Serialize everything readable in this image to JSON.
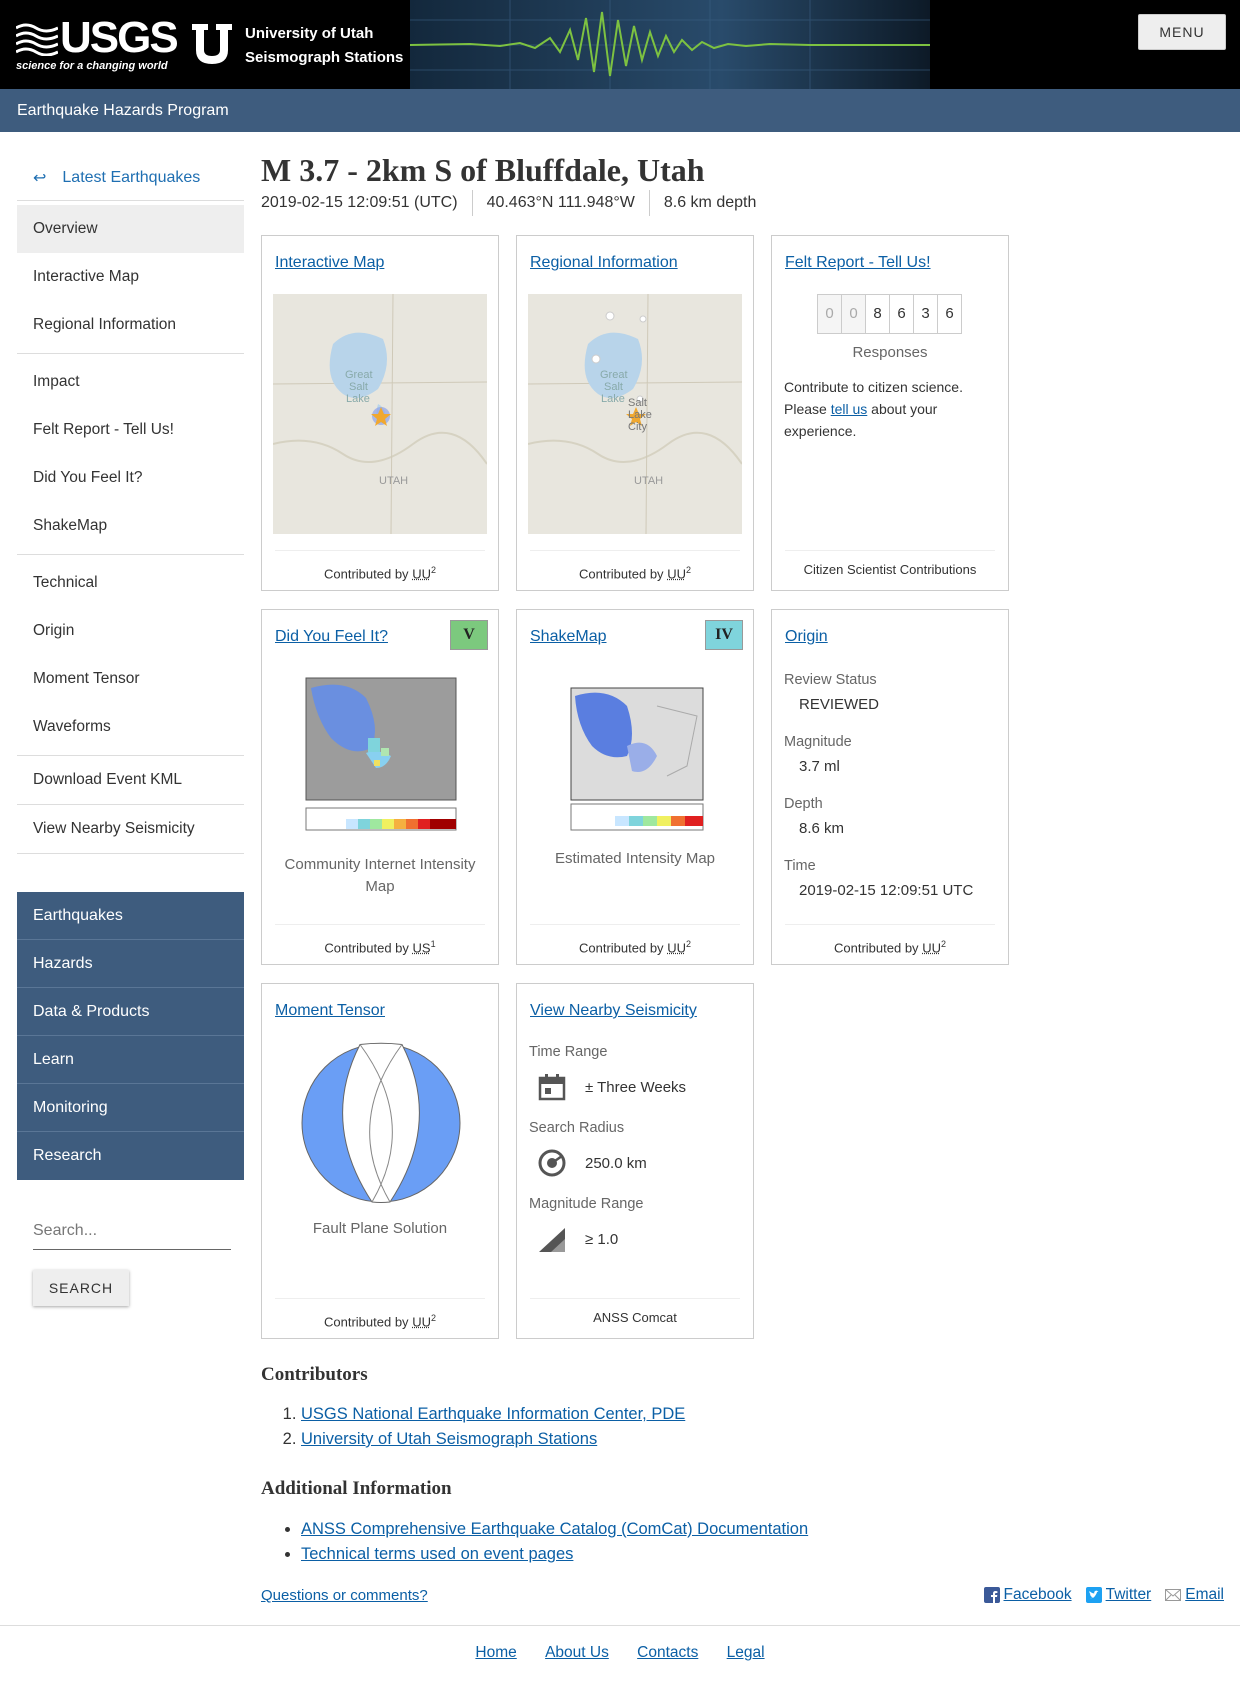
{
  "header": {
    "usgs_wordmark": "USGS",
    "usgs_tagline": "science for a changing world",
    "uu_line1": "University of Utah",
    "uu_line2": "Seismograph Stations",
    "menu_label": "MENU"
  },
  "program_bar": {
    "title": "Earthquake Hazards Program"
  },
  "sidebar": {
    "back_label": "Latest Earthquakes",
    "groups": [
      [
        "Overview",
        "Interactive Map",
        "Regional Information"
      ],
      [
        "Impact",
        "Felt Report - Tell Us!",
        "Did You Feel It?",
        "ShakeMap"
      ],
      [
        "Technical",
        "Origin",
        "Moment Tensor",
        "Waveforms"
      ],
      [
        "Download Event KML"
      ],
      [
        "View Nearby Seismicity"
      ]
    ],
    "active": "Overview",
    "site_nav": [
      "Earthquakes",
      "Hazards",
      "Data & Products",
      "Learn",
      "Monitoring",
      "Research"
    ],
    "search_placeholder": "Search...",
    "search_button": "SEARCH"
  },
  "event": {
    "title": "M 3.7 - 2km S of Bluffdale, Utah",
    "time": "2019-02-15 12:09:51 (UTC)",
    "location": "40.463°N 111.948°W",
    "depth": "8.6 km depth"
  },
  "cards": {
    "interactive_map": {
      "title": "Interactive Map",
      "footer_prefix": "Contributed by",
      "footer_source": "UU",
      "footer_sup": "2",
      "map_labels": [
        "Great",
        "Salt",
        "Lake",
        "UTAH"
      ]
    },
    "regional_info": {
      "title": "Regional Information",
      "footer_prefix": "Contributed by",
      "footer_source": "UU",
      "footer_sup": "2",
      "map_labels": [
        "Great",
        "Salt",
        "Lake",
        "Salt",
        "Lake",
        "City",
        "UTAH"
      ]
    },
    "felt_report": {
      "title": "Felt Report - Tell Us!",
      "digits": [
        "0",
        "0",
        "8",
        "6",
        "3",
        "6"
      ],
      "responses_label": "Responses",
      "text_before": "Contribute to citizen science. Please ",
      "text_link": "tell us",
      "text_after": " about your experience.",
      "footer": "Citizen Scientist Contributions"
    },
    "dyfi": {
      "title": "Did You Feel It?",
      "badge": "V",
      "badge_color": "#7cc97e",
      "caption": "Community Internet Intensity Map",
      "footer_prefix": "Contributed by",
      "footer_source": "US",
      "footer_sup": "1"
    },
    "shakemap": {
      "title": "ShakeMap",
      "badge": "IV",
      "badge_color": "#7fd4dc",
      "caption": "Estimated Intensity Map",
      "footer_prefix": "Contributed by",
      "footer_source": "UU",
      "footer_sup": "2"
    },
    "origin": {
      "title": "Origin",
      "items": [
        {
          "term": "Review Status",
          "value": "REVIEWED"
        },
        {
          "term": "Magnitude",
          "value": "3.7 ml"
        },
        {
          "term": "Depth",
          "value": "8.6 km"
        },
        {
          "term": "Time",
          "value": "2019-02-15 12:09:51 UTC"
        }
      ],
      "footer_prefix": "Contributed by",
      "footer_source": "UU",
      "footer_sup": "2"
    },
    "moment_tensor": {
      "title": "Moment Tensor",
      "caption": "Fault Plane Solution",
      "beachball_color": "#6a9ef5",
      "footer_prefix": "Contributed by",
      "footer_source": "UU",
      "footer_sup": "2"
    },
    "nearby": {
      "title": "View Nearby Seismicity",
      "rows": [
        {
          "term": "Time Range",
          "icon": "calendar-icon",
          "value": "± Three Weeks"
        },
        {
          "term": "Search Radius",
          "icon": "radius-icon",
          "value": "250.0 km"
        },
        {
          "term": "Magnitude Range",
          "icon": "magnitude-icon",
          "value": "≥ 1.0"
        }
      ],
      "footer": "ANSS Comcat"
    }
  },
  "contributors": {
    "heading": "Contributors",
    "items": [
      "USGS National Earthquake Information Center, PDE",
      "University of Utah Seismograph Stations"
    ]
  },
  "additional": {
    "heading": "Additional Information",
    "items": [
      "ANSS Comprehensive Earthquake Catalog (ComCat) Documentation",
      "Technical terms used on event pages"
    ]
  },
  "footer": {
    "questions": "Questions or comments?",
    "social": [
      "Facebook",
      "Twitter",
      "Email"
    ],
    "nav": [
      "Home",
      "About Us",
      "Contacts",
      "Legal"
    ]
  },
  "colors": {
    "header_bg": "#000000",
    "program_bar": "#3e5c7e",
    "link": "#0b5fa5",
    "seismogram": "#7dc241"
  }
}
